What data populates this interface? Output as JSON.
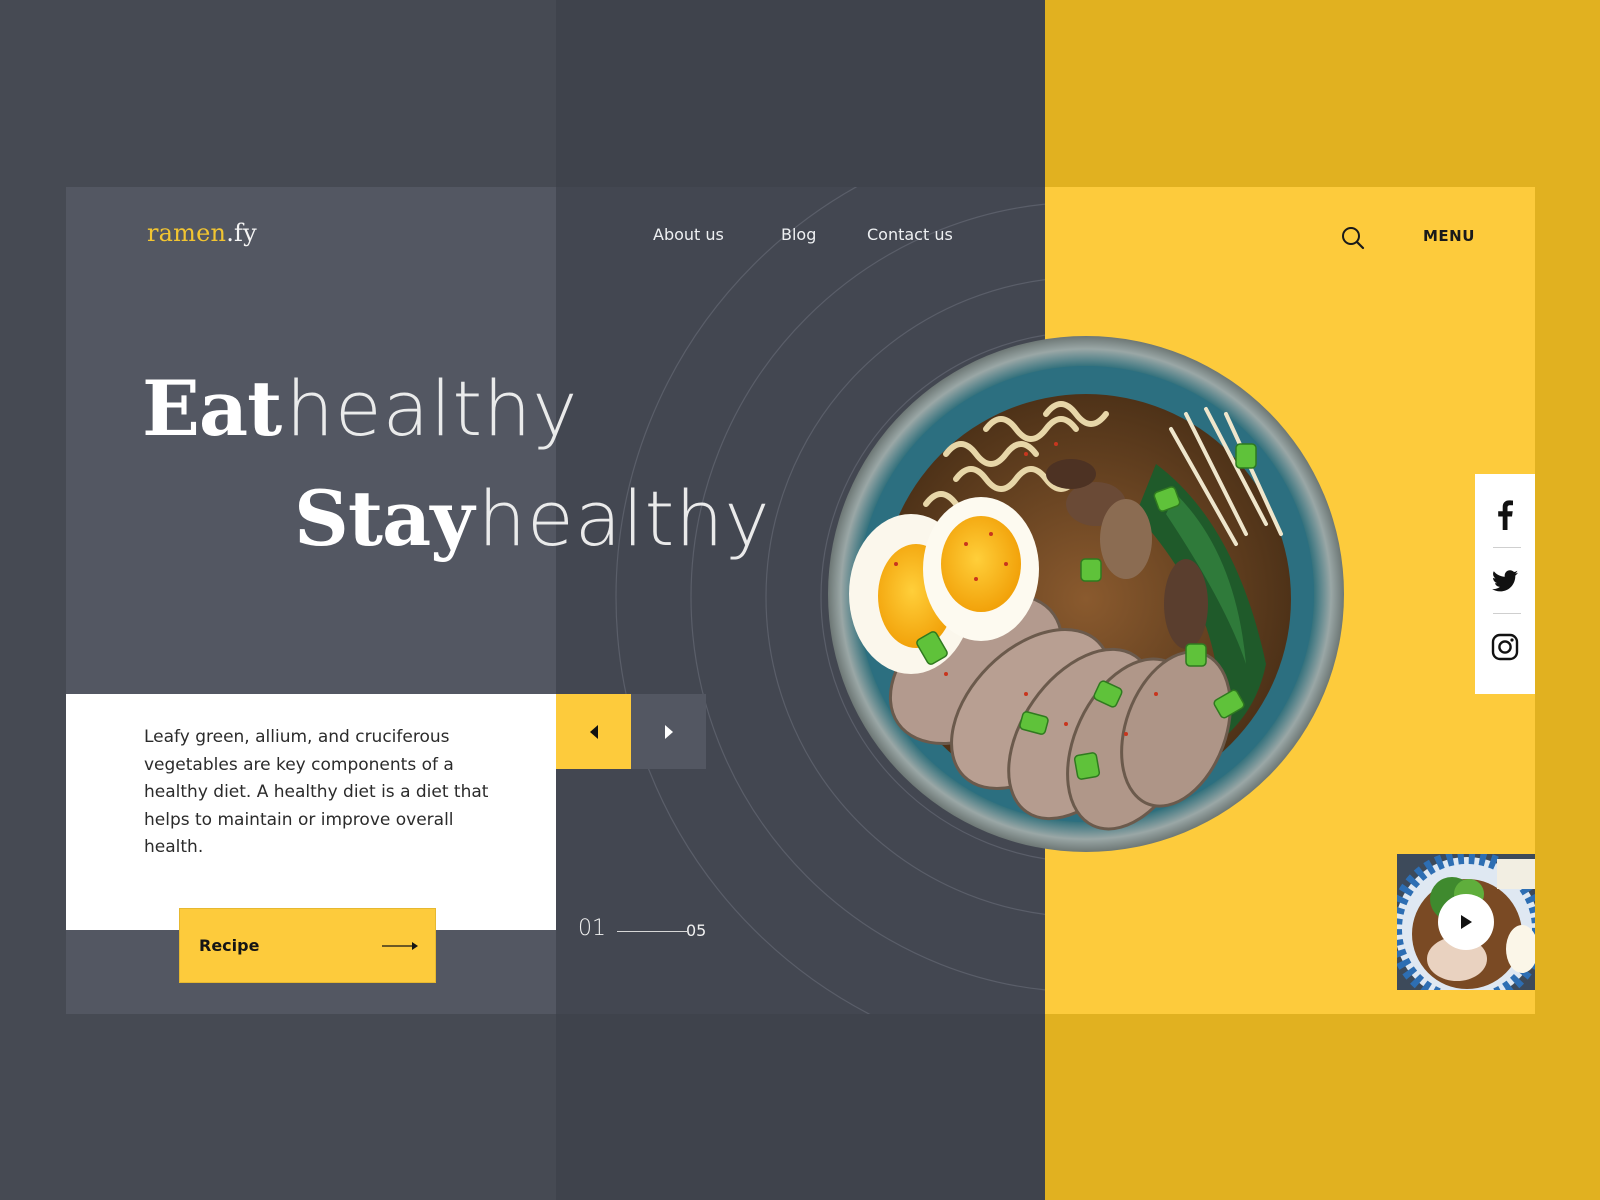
{
  "brand": {
    "name_part1": "ramen",
    "name_part2": ".fy"
  },
  "nav": {
    "items": [
      {
        "label": "About us"
      },
      {
        "label": "Blog"
      },
      {
        "label": "Contact us"
      }
    ],
    "search_icon": "search-icon",
    "menu_label": "MENU"
  },
  "hero": {
    "line1_bold": "Eat",
    "line1_thin": "healthy",
    "line2_bold": "Stay",
    "line2_thin": "healthy",
    "description": "Leafy green, allium, and cruciferous vegetables are key components of a healthy diet. A healthy diet is a diet that helps to maintain or improve overall health.",
    "cta_label": "Recipe",
    "cta_icon": "arrow-right-icon"
  },
  "slider": {
    "prev_icon": "caret-left-icon",
    "next_icon": "caret-right-icon",
    "current": "01",
    "total": "05"
  },
  "social": [
    {
      "name": "facebook",
      "icon": "facebook-icon"
    },
    {
      "name": "twitter",
      "icon": "twitter-icon"
    },
    {
      "name": "instagram",
      "icon": "instagram-icon"
    }
  ],
  "video": {
    "play_icon": "play-icon"
  },
  "colors": {
    "accent_yellow": "#fdcb3c",
    "outer_yellow": "#e1b120",
    "dark_panel": "#434751",
    "mid_panel": "#535762",
    "logo_yellow": "#f2c531"
  }
}
